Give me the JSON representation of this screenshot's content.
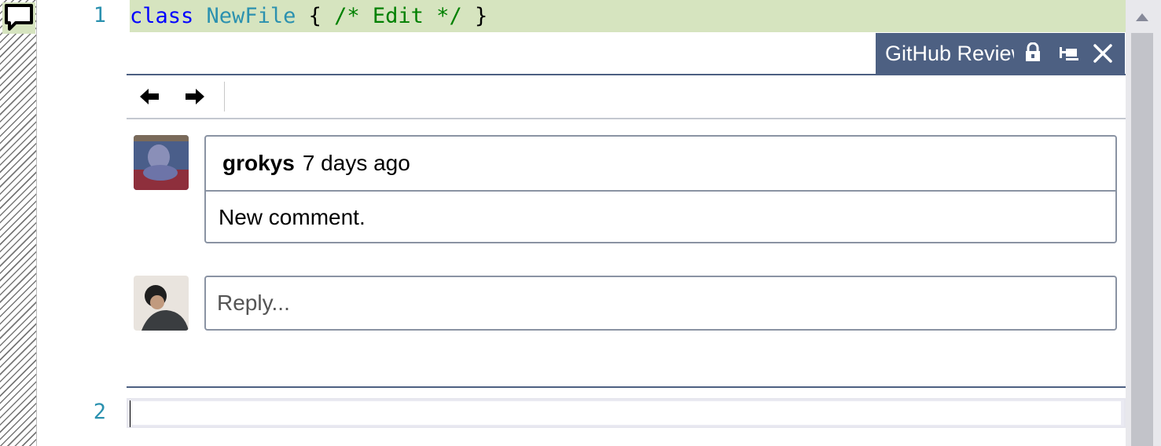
{
  "editor": {
    "line1_number": "1",
    "line2_number": "2",
    "line1_tokens": {
      "keyword": "class",
      "type_name": "NewFile",
      "open_brace": "{",
      "comment": "/* Edit */",
      "close_brace": "}"
    }
  },
  "peek": {
    "tab_title": "GitHub Review",
    "toolbar": {
      "back_icon": "arrow-left-icon",
      "forward_icon": "arrow-right-icon"
    },
    "comment": {
      "author": "grokys",
      "timestamp": "7 days ago",
      "body": "New comment."
    },
    "reply": {
      "placeholder": "Reply..."
    }
  },
  "colors": {
    "highlight_line": "#d6e4bf",
    "peek_accent": "#4d6082",
    "line_number": "#2b91af"
  }
}
